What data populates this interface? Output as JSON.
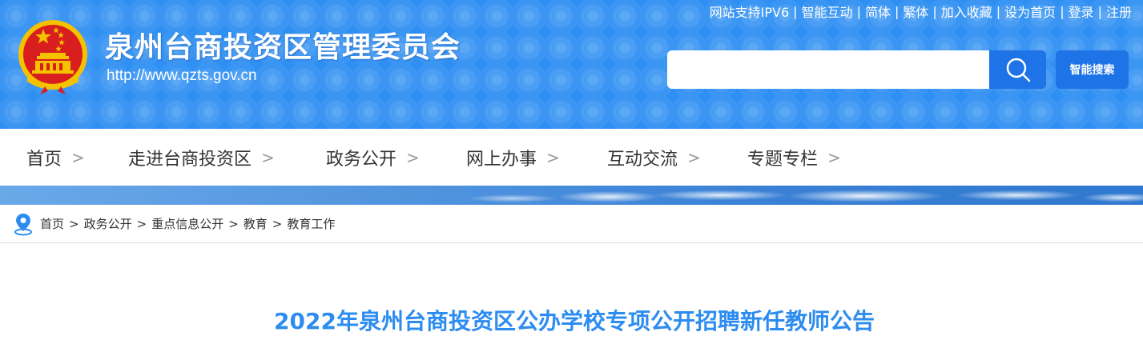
{
  "header": {
    "site_title": "泉州台商投资区管理委员会",
    "site_url": "http://www.qzts.gov.cn",
    "emblem_icon": "national-emblem-icon",
    "top_links": [
      "网站支持IPV6",
      "智能互动",
      "简体",
      "繁体",
      "加入收藏",
      "设为首页",
      "登录",
      "注册"
    ],
    "top_links_separator": "|",
    "search": {
      "placeholder": "",
      "value": "",
      "button_icon": "search-icon",
      "smart_search_label": "智能搜索"
    }
  },
  "nav": {
    "items": [
      {
        "label": "首页"
      },
      {
        "label": "走进台商投资区"
      },
      {
        "label": "政务公开"
      },
      {
        "label": "网上办事"
      },
      {
        "label": "互动交流"
      },
      {
        "label": "专题专栏"
      }
    ],
    "chevron": ">"
  },
  "breadcrumb": {
    "icon": "location-pin-icon",
    "separator": ">",
    "items": [
      "首页",
      "政务公开",
      "重点信息公开",
      "教育",
      "教育工作"
    ]
  },
  "article": {
    "title": "2022年泉州台商投资区公办学校专项公开招聘新任教师公告"
  },
  "colors": {
    "header_bg": "#2f8ff2",
    "button_bg": "#1e73e6",
    "title_color": "#2d8cf0",
    "emblem_red": "#d81e1e",
    "emblem_gold": "#f5c200"
  }
}
